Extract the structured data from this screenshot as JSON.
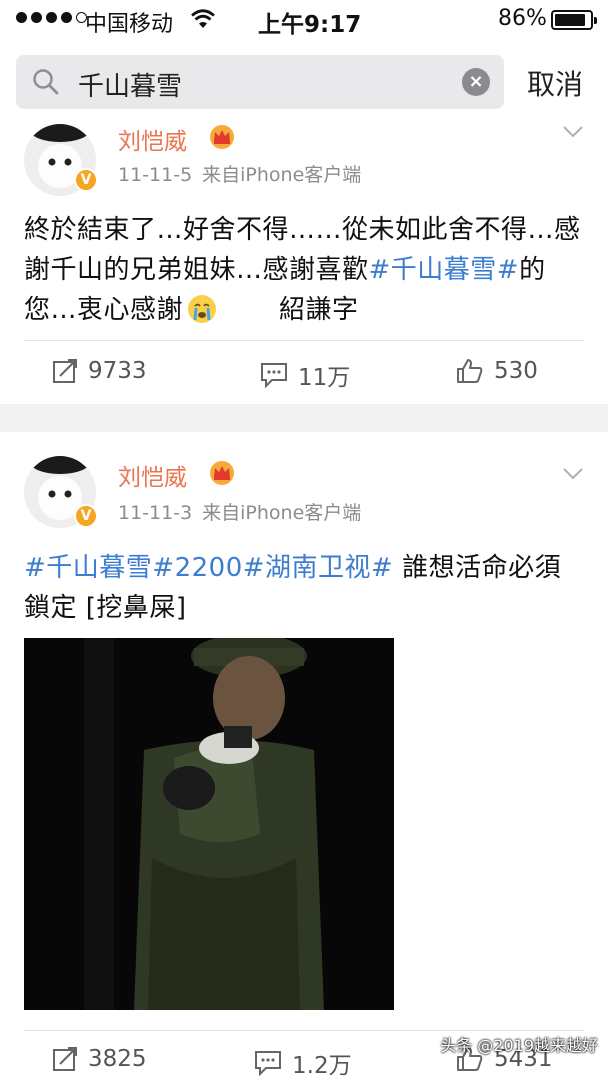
{
  "status_bar": {
    "carrier": "中国移动",
    "time": "上午9:17",
    "battery": "86%"
  },
  "search": {
    "query": "千山暮雪",
    "cancel_label": "取消"
  },
  "posts": [
    {
      "user": "刘恺威",
      "date": "11-11-5",
      "source": "来自iPhone客户端",
      "text_part1": "終於結束了…好舍不得……從未如此舍不得…感謝千山的兄弟姐妹…感謝喜歡",
      "topic": "#千山暮雪#",
      "text_part2": "的您…衷心感謝",
      "signature": "紹謙字",
      "reposts": "9733",
      "comments": "11万",
      "likes": "530"
    },
    {
      "user": "刘恺威",
      "date": "11-11-3",
      "source": "来自iPhone客户端",
      "topic1": "#千山暮雪#",
      "topic_num": "2200",
      "topic2": "#湖南卫视#",
      "text": " 誰想活命必須鎖定 [挖鼻屎]",
      "reposts": "3825",
      "comments": "1.2万",
      "likes": "5431"
    }
  ],
  "watermark": "头条 @2019越来越好",
  "colors": {
    "username": "#eb7350",
    "topic": "#3d7dd0",
    "verified": "#f5a623"
  }
}
